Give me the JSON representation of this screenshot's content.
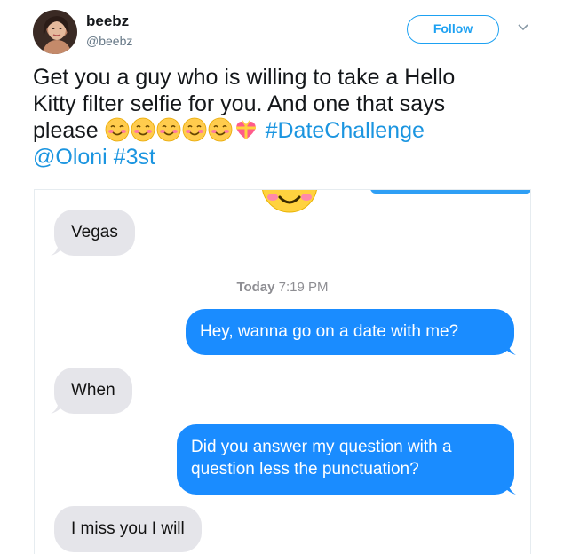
{
  "tweet": {
    "display_name": "beebz",
    "handle": "@beebz",
    "follow_label": "Follow",
    "text_line_1": "Get you a guy who is willing to take a Hello",
    "text_line_2": "Kitty filter selfie for you. And one that says",
    "text_line_3_prefix": "please",
    "hashtag_date": "#DateChallenge",
    "mention": "@Oloni",
    "hashtag_3st": "#3st"
  },
  "conversation": {
    "msg_vegas": "Vegas",
    "timestamp_day": "Today",
    "timestamp_time": "7:19 PM",
    "msg_date_question": "Hey, wanna go on a date with me?",
    "msg_when": "When",
    "msg_answer_question": "Did you answer my question with a question less the punctuation?",
    "msg_miss_you": "I miss you I will"
  },
  "colors": {
    "link_blue": "#1b95e0",
    "follow_blue": "#1da1f2",
    "imessage_blue": "#1a8cff",
    "incoming_gray": "#e5e5ea"
  },
  "icons": {
    "smiling_emoji": "smiling-face-with-smiling-eyes",
    "heart_emoji": "heart-with-ribbon",
    "menu": "chevron-down-icon"
  }
}
